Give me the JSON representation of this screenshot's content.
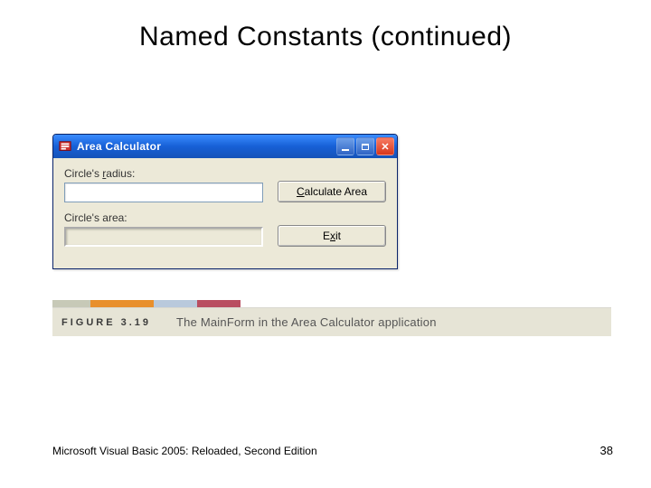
{
  "title": "Named Constants (continued)",
  "window": {
    "title": "Area Calculator",
    "radius_label_pre": "Circle's ",
    "radius_accel": "r",
    "radius_label_post": "adius:",
    "radius_value": "",
    "area_label": "Circle's area:",
    "area_value": "",
    "calc_pre": "",
    "calc_accel": "C",
    "calc_post": "alculate Area",
    "exit_pre": "E",
    "exit_accel": "x",
    "exit_post": "it"
  },
  "figure": {
    "label": "FIGURE 3.19",
    "caption": "The MainForm in the Area Calculator application"
  },
  "footer": {
    "left": "Microsoft Visual Basic 2005: Reloaded, Second Edition",
    "page": "38"
  }
}
